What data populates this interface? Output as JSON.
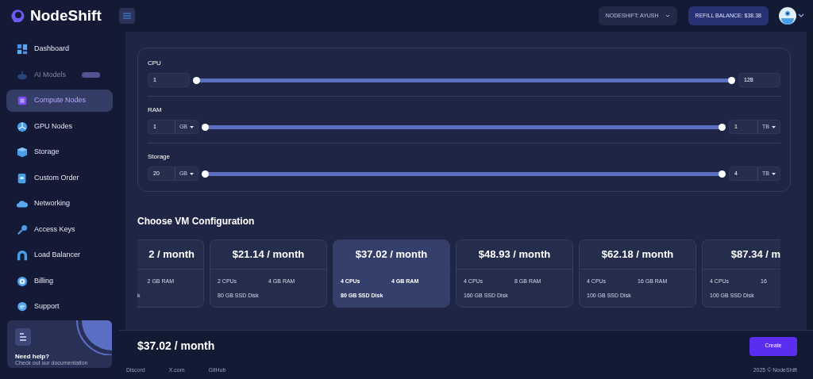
{
  "brand": "NodeShift",
  "sidebar": {
    "items": [
      {
        "label": "Dashboard",
        "selected": false,
        "disabled": false
      },
      {
        "label": "AI Models",
        "selected": false,
        "disabled": true,
        "badge": true
      },
      {
        "label": "Compute Nodes",
        "selected": true,
        "disabled": false
      },
      {
        "label": "GPU Nodes",
        "selected": false,
        "disabled": false
      },
      {
        "label": "Storage",
        "selected": false,
        "disabled": false
      },
      {
        "label": "Custom Order",
        "selected": false,
        "disabled": false
      },
      {
        "label": "Networking",
        "selected": false,
        "disabled": false
      },
      {
        "label": "Access Keys",
        "selected": false,
        "disabled": false
      },
      {
        "label": "Load Balancer",
        "selected": false,
        "disabled": false
      },
      {
        "label": "Billing",
        "selected": false,
        "disabled": false
      },
      {
        "label": "Support",
        "selected": false,
        "disabled": false
      }
    ],
    "help": {
      "title": "Need help?",
      "text": "Check out our documentation"
    }
  },
  "topbar": {
    "account": "NODESHIFT: AYUSH",
    "refill": "REFILL BALANCE: $38.38"
  },
  "filters": [
    {
      "label": "CPU",
      "min": "1",
      "max": "128"
    },
    {
      "label": "RAM",
      "min": "1",
      "min_unit": "GB",
      "max": "1",
      "max_unit": "TB"
    },
    {
      "label": "Storage",
      "min": "20",
      "min_unit": "GB",
      "max": "4",
      "max_unit": "TB"
    }
  ],
  "configurations": {
    "title": "Choose VM Configuration",
    "cards": [
      {
        "price": "2 / month",
        "ram": "2 GB RAM",
        "disk": "k",
        "selected": false
      },
      {
        "price": "$21.14 / month",
        "cpus": "2 CPUs",
        "ram": "4 GB RAM",
        "disk": "80 GB SSD Disk",
        "selected": false
      },
      {
        "price": "$37.02 / month",
        "cpus": "4 CPUs",
        "ram": "4 GB RAM",
        "disk": "80 GB SSD Disk",
        "selected": true
      },
      {
        "price": "$48.93 / month",
        "cpus": "4 CPUs",
        "ram": "8 GB RAM",
        "disk": "160 GB SSD Disk",
        "selected": false
      },
      {
        "price": "$62.18 / month",
        "cpus": "4 CPUs",
        "ram": "16 GB RAM",
        "disk": "100 GB SSD Disk",
        "selected": false
      },
      {
        "price": "$87.34 / m",
        "cpus": "4 CPUs",
        "ram": "16",
        "disk": "100 GB SSD Disk",
        "selected": false
      }
    ]
  },
  "summary": {
    "price": "$37.02 / month",
    "button": "Create"
  },
  "footer": {
    "links": [
      "Discord",
      "X.com",
      "GitHub"
    ],
    "copyright": "2025 © NodeShift"
  }
}
